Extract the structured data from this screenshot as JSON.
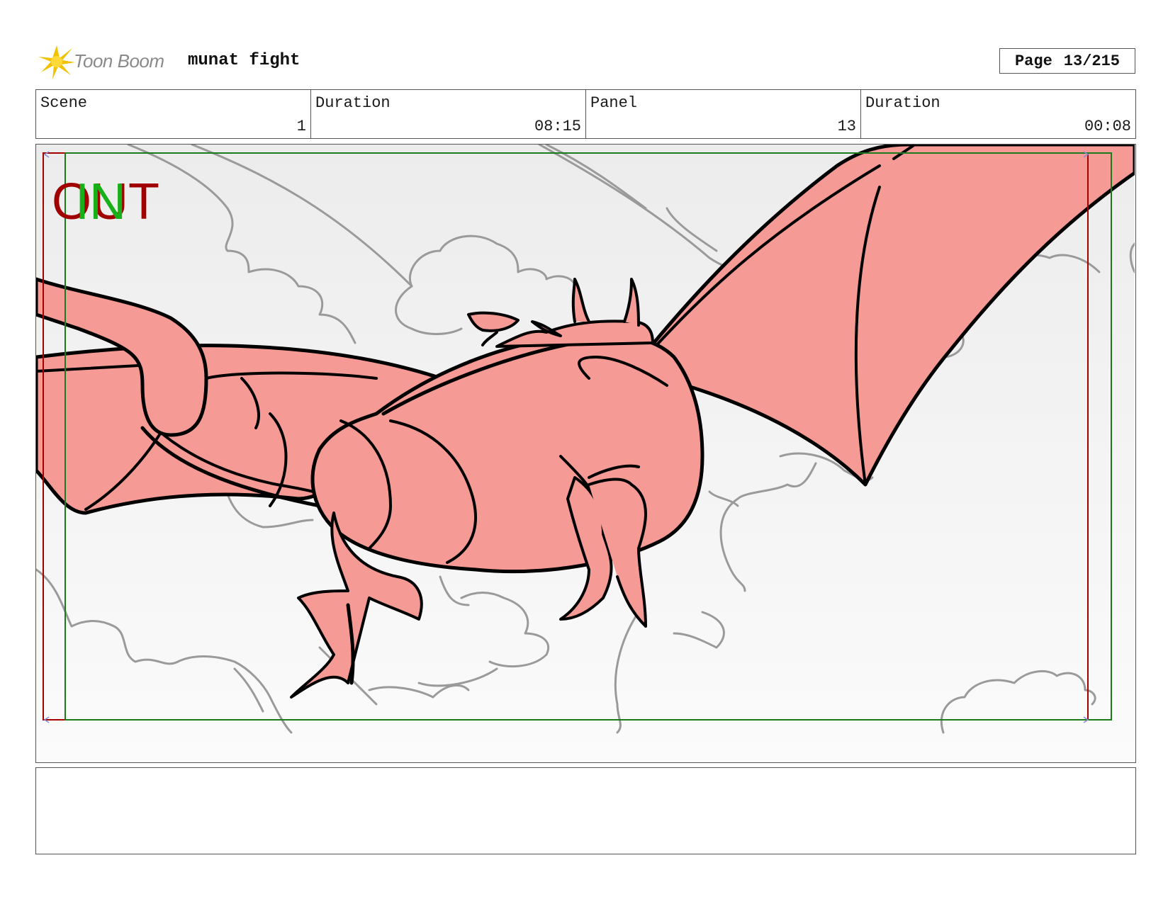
{
  "header": {
    "logo_text": "Toon Boom",
    "project_title": "munat fight",
    "page_label": "Page",
    "page_number": "13/215"
  },
  "info": {
    "scene_label": "Scene",
    "scene_value": "1",
    "scene_duration_label": "Duration",
    "scene_duration_value": "08:15",
    "panel_label": "Panel",
    "panel_value": "13",
    "panel_duration_label": "Duration",
    "panel_duration_value": "00:08"
  },
  "panel": {
    "out_marker": "OUT",
    "in_marker": "IN",
    "out_color": "#a00000",
    "in_color": "#18b018",
    "dragon_fill": "#f59a94"
  },
  "notes": {
    "text": ""
  }
}
